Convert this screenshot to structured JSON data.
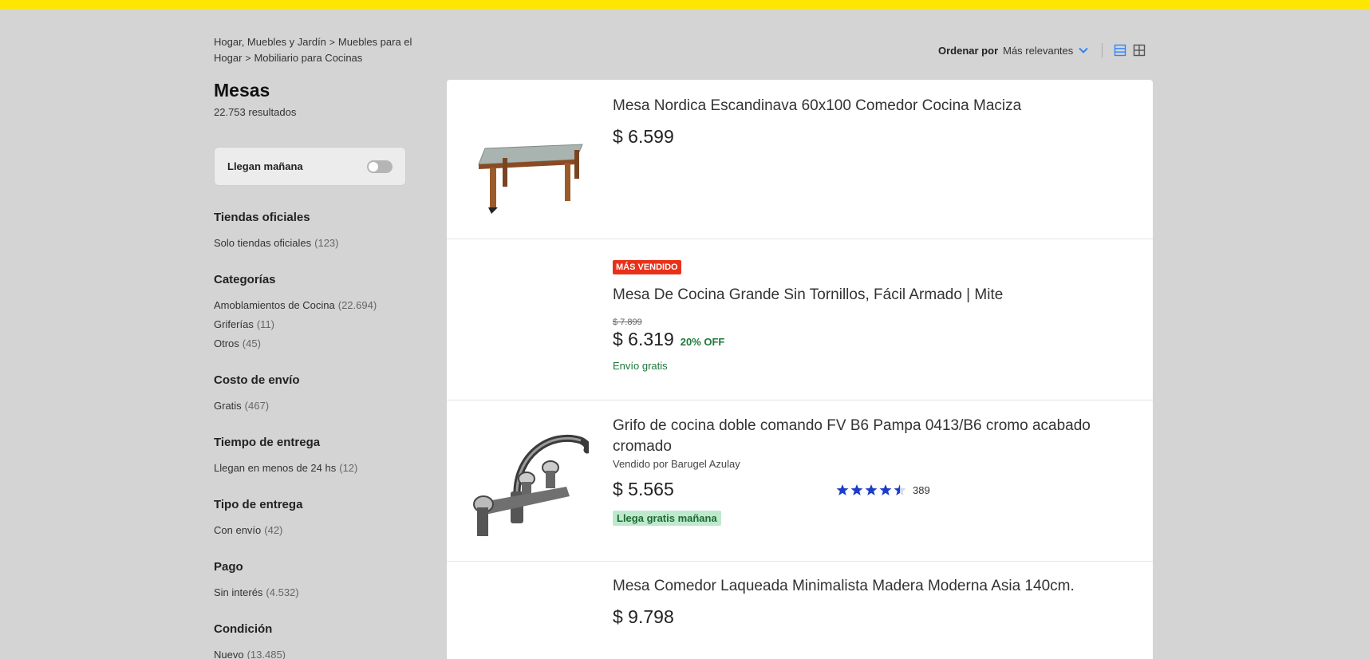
{
  "breadcrumb": {
    "items": [
      "Hogar, Muebles y Jardín",
      "Muebles para el Hogar",
      "Mobiliario para Cocinas"
    ]
  },
  "sort": {
    "label": "Ordenar por",
    "value": "Más relevantes",
    "accent": "#3483fa"
  },
  "sidebar": {
    "title": "Mesas",
    "results": "22.753 resultados",
    "toggle_label": "Llegan mañana",
    "filters": [
      {
        "heading": "Tiendas oficiales",
        "items": [
          {
            "label": "Solo tiendas oficiales",
            "count": "(123)"
          }
        ]
      },
      {
        "heading": "Categorías",
        "items": [
          {
            "label": "Amoblamientos de Cocina",
            "count": "(22.694)"
          },
          {
            "label": "Griferías",
            "count": "(11)"
          },
          {
            "label": "Otros",
            "count": "(45)"
          }
        ]
      },
      {
        "heading": "Costo de envío",
        "items": [
          {
            "label": "Gratis",
            "count": "(467)"
          }
        ]
      },
      {
        "heading": "Tiempo de entrega",
        "items": [
          {
            "label": "Llegan en menos de 24 hs",
            "count": "(12)"
          }
        ]
      },
      {
        "heading": "Tipo de entrega",
        "items": [
          {
            "label": "Con envío",
            "count": "(42)"
          }
        ]
      },
      {
        "heading": "Pago",
        "items": [
          {
            "label": "Sin interés",
            "count": "(4.532)"
          }
        ]
      },
      {
        "heading": "Condición",
        "items": [
          {
            "label": "Nuevo",
            "count": "(13.485)"
          }
        ]
      }
    ]
  },
  "products": [
    {
      "title": "Mesa Nordica Escandinava 60x100 Comedor Cocina Maciza",
      "price": "$ 6.599",
      "image": "table-image"
    },
    {
      "badge": "MÁS VENDIDO",
      "title": "Mesa De Cocina Grande Sin Tornillos, Fácil Armado | Mite",
      "old_price": "$ 7.899",
      "price": "$ 6.319",
      "discount": "20% OFF",
      "shipping": "Envío gratis"
    },
    {
      "title": "Grifo de cocina doble comando FV B6 Pampa 0413/B6 cromo acabado cromado",
      "seller": "Vendido por Barugel Azulay",
      "price": "$ 5.565",
      "rating": 4.5,
      "rating_count": "389",
      "arrival": "Llega gratis mañana",
      "image": "faucet-image"
    },
    {
      "title": "Mesa Comedor Laqueada Minimalista Madera Moderna Asia 140cm.",
      "price": "$ 9.798"
    }
  ],
  "colors": {
    "brand_yellow": "#ffe600",
    "badge_red": "#e9311a",
    "star_blue": "#3483fa",
    "green": "#1d7a3a"
  }
}
